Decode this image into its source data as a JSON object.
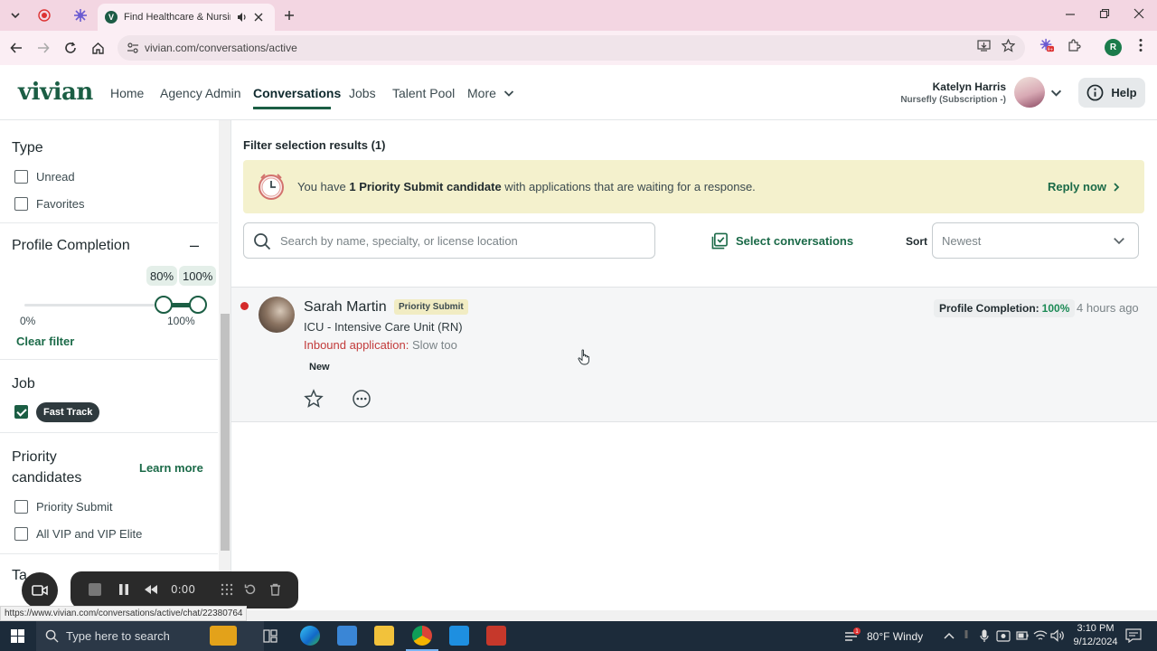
{
  "browser": {
    "tab_title": "Find Healthcare & Nursing",
    "url": "vivian.com/conversations/active",
    "profile_initial": "R",
    "extension_badge": "9+"
  },
  "app": {
    "logo": "vivian",
    "brand_color": "#1b5e44",
    "nav": [
      "Home",
      "Agency Admin",
      "Conversations",
      "Jobs",
      "Talent Pool",
      "More"
    ],
    "active_nav": "Conversations",
    "user_name": "Katelyn Harris",
    "user_org": "Nursefly (Subscription -)",
    "help_label": "Help"
  },
  "sidebar": {
    "type_title": "Type",
    "type_options": [
      "Unread",
      "Favorites"
    ],
    "profile_completion_title": "Profile Completion",
    "collapse_symbol": "–",
    "range_min_value": "80%",
    "range_max_value": "100%",
    "range_scale_min": "0%",
    "range_scale_max": "100%",
    "range_low_fraction": 0.8,
    "range_high_fraction": 1.0,
    "clear_filter": "Clear filter",
    "job_title": "Job",
    "job_tag": "Fast Track",
    "priority_title_line1": "Priority",
    "priority_title_line2": "candidates",
    "learn_more": "Learn more",
    "priority_options": [
      "Priority Submit",
      "All VIP and VIP Elite"
    ],
    "tags_title_partial": "Ta"
  },
  "main": {
    "results_title": "Filter selection results (1)",
    "banner": {
      "prefix": "You have ",
      "bold": "1 Priority Submit candidate",
      "suffix": " with applications that are waiting for a response.",
      "action": "Reply now"
    },
    "search_placeholder": "Search by name, specialty, or license location",
    "select_conversations": "Select conversations",
    "sort_label": "Sort",
    "sort_value": "Newest"
  },
  "conversation": {
    "name": "Sarah Martin",
    "badge": "Priority Submit",
    "specialty": "ICU - Intensive Care Unit (RN)",
    "source_label": "Inbound application:",
    "source_message": "Slow too",
    "status_chip": "New",
    "profile_completion_label": "Profile Completion:",
    "profile_completion_value": "100%",
    "time_ago": "4 hours ago"
  },
  "recorder": {
    "time": "0:00"
  },
  "status_url": "https://www.vivian.com/conversations/active/chat/22380764",
  "taskbar": {
    "search_placeholder": "Type here to search",
    "weather": "80°F  Windy",
    "time": "3:10 PM",
    "date": "9/12/2024",
    "weather_badge": "1"
  }
}
